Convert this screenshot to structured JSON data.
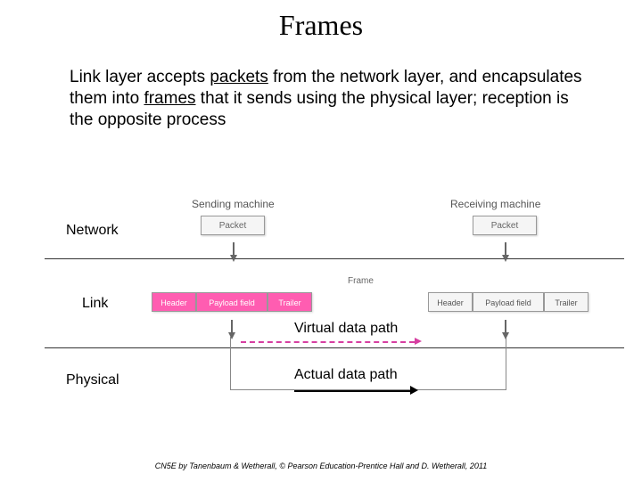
{
  "title": "Frames",
  "paragraph": {
    "pre1": "Link layer accepts ",
    "u1": "packets",
    "mid1": " from the network layer, and encapsulates them into ",
    "u2": "frames",
    "post": " that it sends using the physical layer; reception is the opposite process"
  },
  "layers": {
    "network": "Network",
    "link": "Link",
    "physical": "Physical"
  },
  "machines": {
    "sending": "Sending machine",
    "receiving": "Receiving machine"
  },
  "boxes": {
    "packet": "Packet",
    "header": "Header",
    "payload": "Payload field",
    "trailer": "Trailer",
    "frame_tag": "Frame"
  },
  "paths": {
    "virtual": "Virtual data path",
    "actual": "Actual data path"
  },
  "footer": "CN5E by Tanenbaum & Wetherall, © Pearson Education-Prentice Hall and D. Wetherall, 2011"
}
